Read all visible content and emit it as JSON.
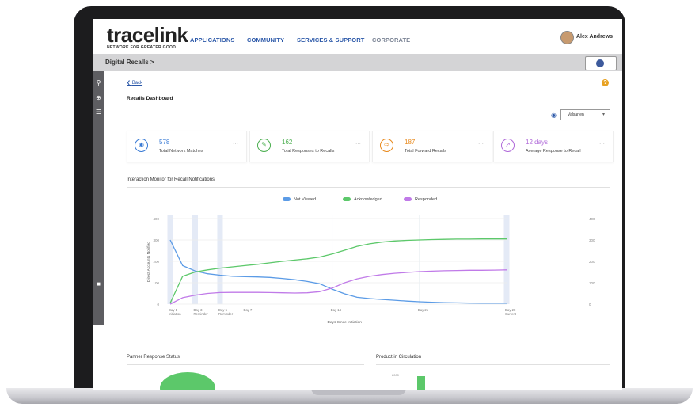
{
  "brand": {
    "name": "tracelink",
    "tagline": "NETWORK FOR GREATER GOOD"
  },
  "nav": {
    "items": [
      {
        "label": "APPLICATIONS",
        "muted": false
      },
      {
        "label": "COMMUNITY",
        "muted": false
      },
      {
        "label": "SERVICES & SUPPORT",
        "muted": false
      },
      {
        "label": "CORPORATE",
        "muted": true
      }
    ],
    "user_name": "Alex Andrews"
  },
  "breadcrumb": {
    "label": "Digital Recalls >"
  },
  "page": {
    "back_label": "Back",
    "title": "Recalls Dashboard",
    "filter_value": "Valsarten",
    "help_icon": "?"
  },
  "cards": [
    {
      "value": "578",
      "label": "Total Network Matches",
      "color": "#3a7bd5",
      "icon": "people-icon"
    },
    {
      "value": "162",
      "label": "Total Responses to Recalls",
      "color": "#4caf50",
      "icon": "pencil-icon"
    },
    {
      "value": "187",
      "label": "Total Forward Recalls",
      "color": "#e8891c",
      "icon": "forward-icon"
    },
    {
      "value": "12 days",
      "label": "Average Response to Recall",
      "color": "#b06ad9",
      "icon": "trend-icon"
    }
  ],
  "more_label": "···",
  "monitor": {
    "title": "Interaction Monitor for Recall Notifications"
  },
  "sections": {
    "partner": "Partner Response Status",
    "product": "Product in Circulation",
    "product_tick": "8000"
  },
  "colors": {
    "not_viewed": "#5b9be6",
    "acknowledged": "#5cc86a",
    "responded": "#c07ae8",
    "accent": "#2a57a8"
  },
  "chart_data": {
    "type": "line",
    "xlabel": "Days Since Initiation",
    "ylabel": "Direct Accounts Notified",
    "x": [
      1,
      2,
      3,
      4,
      5,
      6,
      7,
      8,
      9,
      10,
      11,
      12,
      13,
      14,
      15,
      16,
      17,
      18,
      19,
      20,
      21,
      22,
      23,
      24,
      25,
      26,
      27,
      28
    ],
    "xticks": [
      {
        "x": 1,
        "label": "Day 1",
        "sub": "Initiation"
      },
      {
        "x": 3,
        "label": "Day 3",
        "sub": "Reminder"
      },
      {
        "x": 5,
        "label": "Day 5",
        "sub": "Reminder"
      },
      {
        "x": 7,
        "label": "Day 7",
        "sub": ""
      },
      {
        "x": 14,
        "label": "Day 14",
        "sub": ""
      },
      {
        "x": 21,
        "label": "Day 21",
        "sub": ""
      },
      {
        "x": 28,
        "label": "Day 28",
        "sub": "Current"
      }
    ],
    "ylim": [
      0,
      400
    ],
    "yticks": [
      0,
      100,
      200,
      300,
      400
    ],
    "highlight_days": [
      1,
      3,
      5,
      28
    ],
    "series": [
      {
        "name": "Not Viewed",
        "color": "#5b9be6",
        "values": [
          300,
          180,
          155,
          142,
          135,
          130,
          128,
          127,
          125,
          120,
          114,
          106,
          95,
          70,
          48,
          32,
          26,
          22,
          18,
          14,
          11,
          9,
          7,
          6,
          5,
          4,
          4,
          4
        ]
      },
      {
        "name": "Acknowledged",
        "color": "#5cc86a",
        "values": [
          5,
          130,
          150,
          160,
          168,
          174,
          180,
          186,
          193,
          200,
          206,
          212,
          220,
          234,
          252,
          270,
          282,
          290,
          295,
          298,
          300,
          302,
          303,
          304,
          304,
          305,
          305,
          305
        ]
      },
      {
        "name": "Responded",
        "color": "#c07ae8",
        "values": [
          0,
          30,
          42,
          50,
          54,
          55,
          55,
          55,
          54,
          53,
          52,
          53,
          58,
          75,
          100,
          118,
          130,
          138,
          144,
          148,
          152,
          154,
          156,
          157,
          158,
          158,
          159,
          160
        ]
      }
    ]
  }
}
